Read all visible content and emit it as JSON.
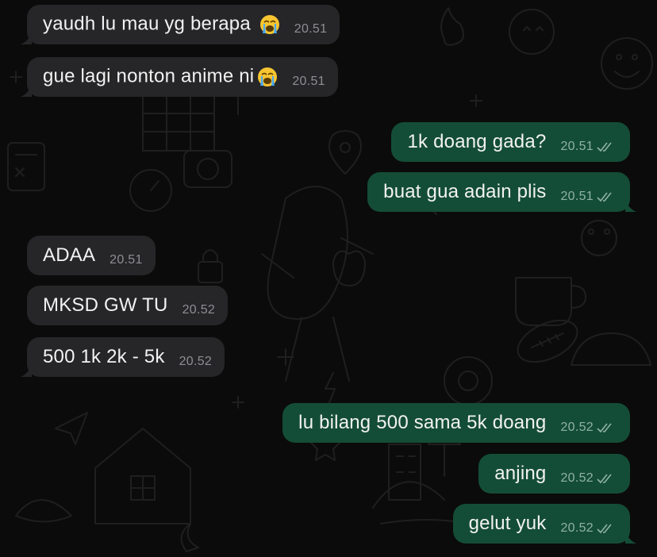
{
  "theme": {
    "background": "#0b0b0b",
    "incoming_bubble": "#262628",
    "outgoing_bubble": "#144d37"
  },
  "messages": [
    {
      "direction": "in",
      "text": "yaudh lu mau yg berapa ",
      "emoji": "loudly-crying-face",
      "time": "20.51"
    },
    {
      "direction": "in",
      "text": "gue lagi nonton anime ni",
      "emoji": "loudly-crying-face",
      "time": "20.51"
    },
    {
      "direction": "out",
      "text": "1k doang gada?",
      "time": "20.51",
      "status": "read"
    },
    {
      "direction": "out",
      "text": "buat gua adain plis",
      "time": "20.51",
      "status": "read"
    },
    {
      "direction": "in",
      "text": "ADAA",
      "time": "20.51"
    },
    {
      "direction": "in",
      "text": "MKSD GW TU",
      "time": "20.52"
    },
    {
      "direction": "in",
      "text": "500 1k 2k - 5k",
      "time": "20.52"
    },
    {
      "direction": "out",
      "text": "lu bilang 500 sama 5k doang",
      "time": "20.52",
      "status": "read"
    },
    {
      "direction": "out",
      "text": "anjing",
      "time": "20.52",
      "status": "read"
    },
    {
      "direction": "out",
      "text": "gelut yuk",
      "time": "20.52",
      "status": "read"
    }
  ]
}
